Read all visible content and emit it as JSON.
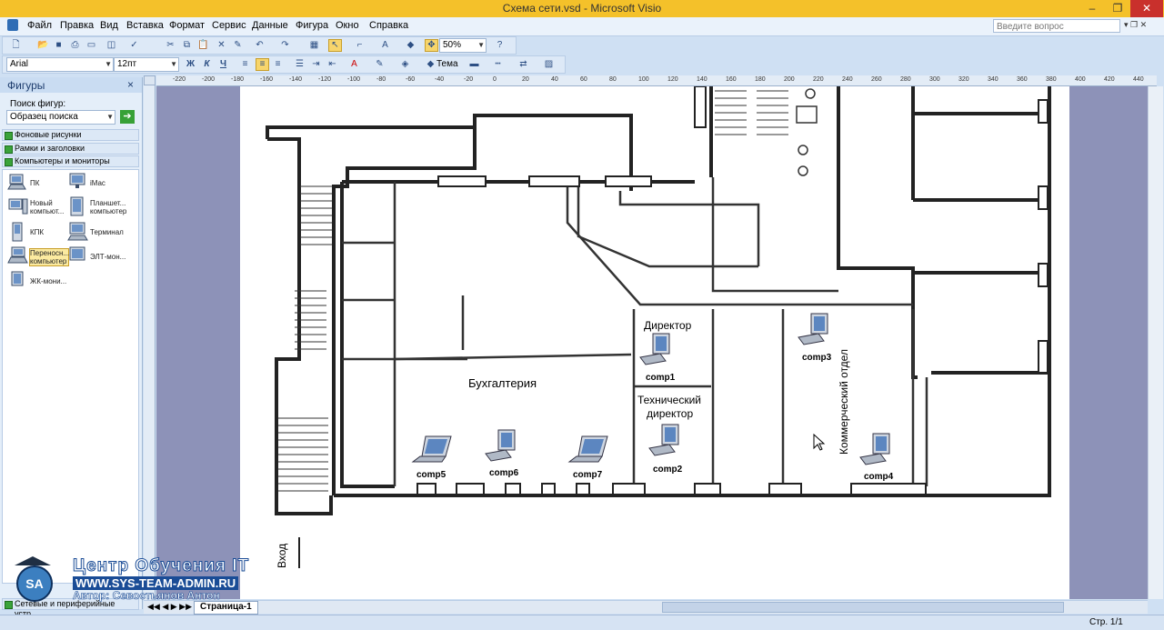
{
  "window": {
    "title": "Схема сети.vsd - Microsoft Visio",
    "ask_placeholder": "Введите вопрос"
  },
  "menu": [
    "Файл",
    "Правка",
    "Вид",
    "Вставка",
    "Формат",
    "Сервис",
    "Данные",
    "Фигура",
    "Окно",
    "Справка"
  ],
  "toolbar": {
    "zoom": "50%",
    "font": "Arial",
    "font_size": "12пт",
    "bold": "Ж",
    "italic": "К",
    "underline": "Ч",
    "theme": "Тема"
  },
  "shapes_panel": {
    "title": "Фигуры",
    "search_label": "Поиск фигур:",
    "search_placeholder": "Образец поиска",
    "stencils": [
      "Фоновые рисунки",
      "Рамки и заголовки",
      "Компьютеры и мониторы"
    ],
    "bottom_stencil": "Сетевые и периферийные устр...",
    "items": [
      {
        "label": "ПК",
        "icon": "pc-icon"
      },
      {
        "label": "iMac",
        "icon": "imac-icon"
      },
      {
        "label": "Новый компьют...",
        "icon": "new-computer-icon"
      },
      {
        "label": "Планшет... компьютер",
        "icon": "tablet-icon"
      },
      {
        "label": "КПК",
        "icon": "pda-icon"
      },
      {
        "label": "Терминал",
        "icon": "terminal-icon"
      },
      {
        "label": "Переносн... компьютер",
        "icon": "laptop-icon"
      },
      {
        "label": "ЭЛТ-мон...",
        "icon": "crt-monitor-icon"
      },
      {
        "label": "ЖК-мони...",
        "icon": "lcd-monitor-icon"
      }
    ]
  },
  "ruler": [
    "-220",
    "-200",
    "-180",
    "-160",
    "-140",
    "-120",
    "-100",
    "-80",
    "-60",
    "-40",
    "-20",
    "0",
    "20",
    "40",
    "60",
    "80",
    "100",
    "120",
    "140",
    "160",
    "180",
    "200",
    "220",
    "240",
    "260",
    "280",
    "300",
    "320",
    "340",
    "360",
    "380",
    "400",
    "420",
    "440"
  ],
  "plan": {
    "rooms": {
      "director": "Директор",
      "tech_director_1": "Технический",
      "tech_director_2": "директор",
      "accounting": "Бухгалтерия",
      "commercial": "Коммерческий отдел",
      "entrance": "Вход"
    },
    "computers": [
      "comp1",
      "comp2",
      "comp3",
      "comp4",
      "comp5",
      "comp6",
      "comp7"
    ]
  },
  "tabs": {
    "page": "Страница-1"
  },
  "status": {
    "page_count": "Стр. 1/1"
  },
  "watermark": {
    "line1": "Центр Обучения IT",
    "line2": "WWW.SYS-TEAM-ADMIN.RU",
    "line3": "Автор: Севостьянов Антон",
    "badge": "SA"
  }
}
